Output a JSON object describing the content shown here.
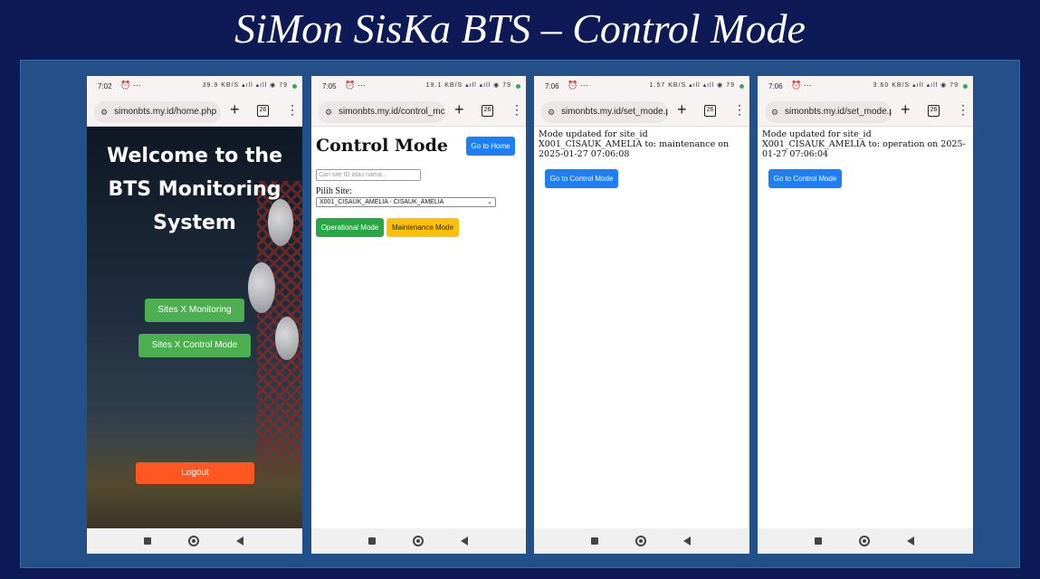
{
  "slide": {
    "title": "SiMon SisKa BTS – Control Mode"
  },
  "phones": [
    {
      "time": "7:02",
      "status_icons": "⏰ ⋯",
      "net": "39.9 KB/S ▴ıll ▴ıll ◉ 79",
      "url": "simonbts.my.id/home.php",
      "tabs": "26",
      "hero_title": "Welcome to the BTS Monitoring System",
      "buttons": [
        "Sites X Monitoring",
        "Sites X Control Mode"
      ],
      "logout": "Logout"
    },
    {
      "time": "7:05",
      "status_icons": "⏰ ⋯",
      "net": "19.1 KB/S ▴ıll ▴ıll ◉ 79",
      "url": "simonbts.my.id/control_mc",
      "tabs": "26",
      "page_title": "Control Mode",
      "home_button": "Go to Home",
      "search_placeholder": "Cari site ID atau nama...",
      "pilih_label": "Pilih Site:",
      "selected_site": "X001_CISAUK_AMELIA - CISAUK_AMELIA",
      "operational_button": "Operational Mode",
      "maintenance_button": "Maintenance Mode"
    },
    {
      "time": "7:06",
      "status_icons": "⏰ ⋯",
      "net": "1.57 KB/S ▴ıll ▴ıll ◉ 79",
      "url": "simonbts.my.id/set_mode.p",
      "tabs": "26",
      "message": "Mode updated for site_id X001_CISAUK_AMELIA to: maintenance on 2025-01-27 07:06:08",
      "back_button": "Go to Control Mode"
    },
    {
      "time": "7:06",
      "status_icons": "⏰ ⋯",
      "net": "3.60 KB/S ▴ıll ▴ıll ◉ 79",
      "url": "simonbts.my.id/set_mode.p",
      "tabs": "26",
      "message": "Mode updated for site_id X001_CISAUK_AMELIA to: operation on 2025-01-27 07:06:04",
      "back_button": "Go to Control Mode"
    }
  ],
  "colors": {
    "background": "#0e1a55",
    "panel": "#24508a",
    "primary_blue": "#1e7ef5",
    "green": "#4caf50",
    "operational_green": "#28a745",
    "maintenance_yellow": "#ffc107",
    "logout_orange": "#ff5722"
  }
}
